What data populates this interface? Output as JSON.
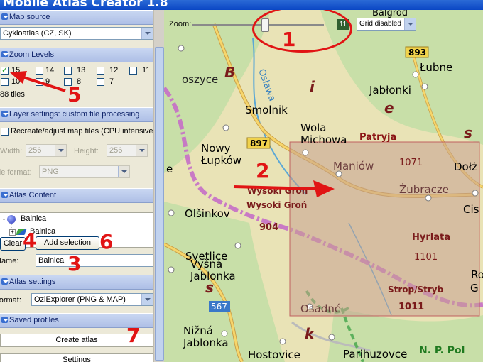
{
  "window": {
    "title": "Mobile Atlas Creator 1.8"
  },
  "sections": {
    "map_source": "Map source",
    "zoom_levels": "Zoom Levels",
    "layer_settings": "Layer settings: custom tile processing",
    "atlas_content": "Atlas Content",
    "atlas_settings": "Atlas settings",
    "saved_profiles": "Saved profiles"
  },
  "map_source": {
    "selected": "Cykloatlas (CZ, SK)"
  },
  "zoom_levels": {
    "levels": [
      {
        "label": "15",
        "checked": true
      },
      {
        "label": "14",
        "checked": false
      },
      {
        "label": "13",
        "checked": false
      },
      {
        "label": "12",
        "checked": false
      },
      {
        "label": "11",
        "checked": false
      },
      {
        "label": "10",
        "checked": false
      },
      {
        "label": "9",
        "checked": false
      },
      {
        "label": "8",
        "checked": false
      },
      {
        "label": "7",
        "checked": false
      }
    ],
    "tiles": "88 tiles"
  },
  "layer_settings": {
    "recreate_label": "Recreate/adjust map tiles (CPU intensive)",
    "width_label": "Width:",
    "width_value": "256",
    "height_label": "Height:",
    "height_value": "256",
    "tile_format_label": "Tile format:",
    "tile_format_value": "PNG"
  },
  "atlas_content": {
    "root": "Balnica",
    "child": "Balnica"
  },
  "buttons": {
    "clear": "Clear",
    "add_selection": "Add selection",
    "create_atlas": "Create atlas",
    "settings": "Settings"
  },
  "name_field": {
    "label": "Name:",
    "value": "Balnica"
  },
  "atlas_settings": {
    "format_label": "Format:",
    "format_value": "OziExplorer (PNG & MAP)"
  },
  "map_toolbar": {
    "zoom_label": "Zoom:",
    "zoom_value": "11",
    "zoom_fraction": 0.55,
    "grid": "Grid disabled"
  },
  "map_labels": {
    "balgrod": "Balgrod",
    "oszyce": "oszyce",
    "b": "B",
    "i": "i",
    "e": "e",
    "s1": "s",
    "oslawa": "Osława",
    "smolnik": "Smolnik",
    "lubne": "Łubne",
    "jablonki": "Jabłonki",
    "r893": "893",
    "wola": "Wola",
    "michowa": "Michowa",
    "patryja": "Patryja",
    "nowy": "Nowy",
    "lupkow": "Łupków",
    "r897": "897",
    "e_left": "e",
    "maniow": "Maniów",
    "h1071": "1071",
    "dolz": "Dołż",
    "zubracze": "Żubracze",
    "cis": "Cis",
    "wysoki_gron1": "Wysoki Groń",
    "wysoki_gron2": "Wysoki Groń",
    "olsinkov": "Olšinkov",
    "h904": "904",
    "hyrlata": "Hyrlata",
    "h1101": "1101",
    "svetlice": "Svetlice",
    "vysna": "Vyšná",
    "jablonka1": "Jablonka",
    "s2": "s",
    "r567": "567",
    "strop": "Strop/Stryb",
    "h1011": "1011",
    "ro": "Ro",
    "g": "G",
    "osadne": "Osadné",
    "nizna": "Nižná",
    "jablonka2": "Jablonka",
    "k": "k",
    "hostovice": "Hostovice",
    "parihuzovce": "Parihuzovce",
    "np": "N. P. Pol"
  },
  "annotations": [
    "1",
    "2",
    "3",
    "4",
    "5",
    "6",
    "7"
  ],
  "colors": {
    "accent": "#e11414",
    "selection": "#c6a08f",
    "route": "#c56ec7"
  }
}
